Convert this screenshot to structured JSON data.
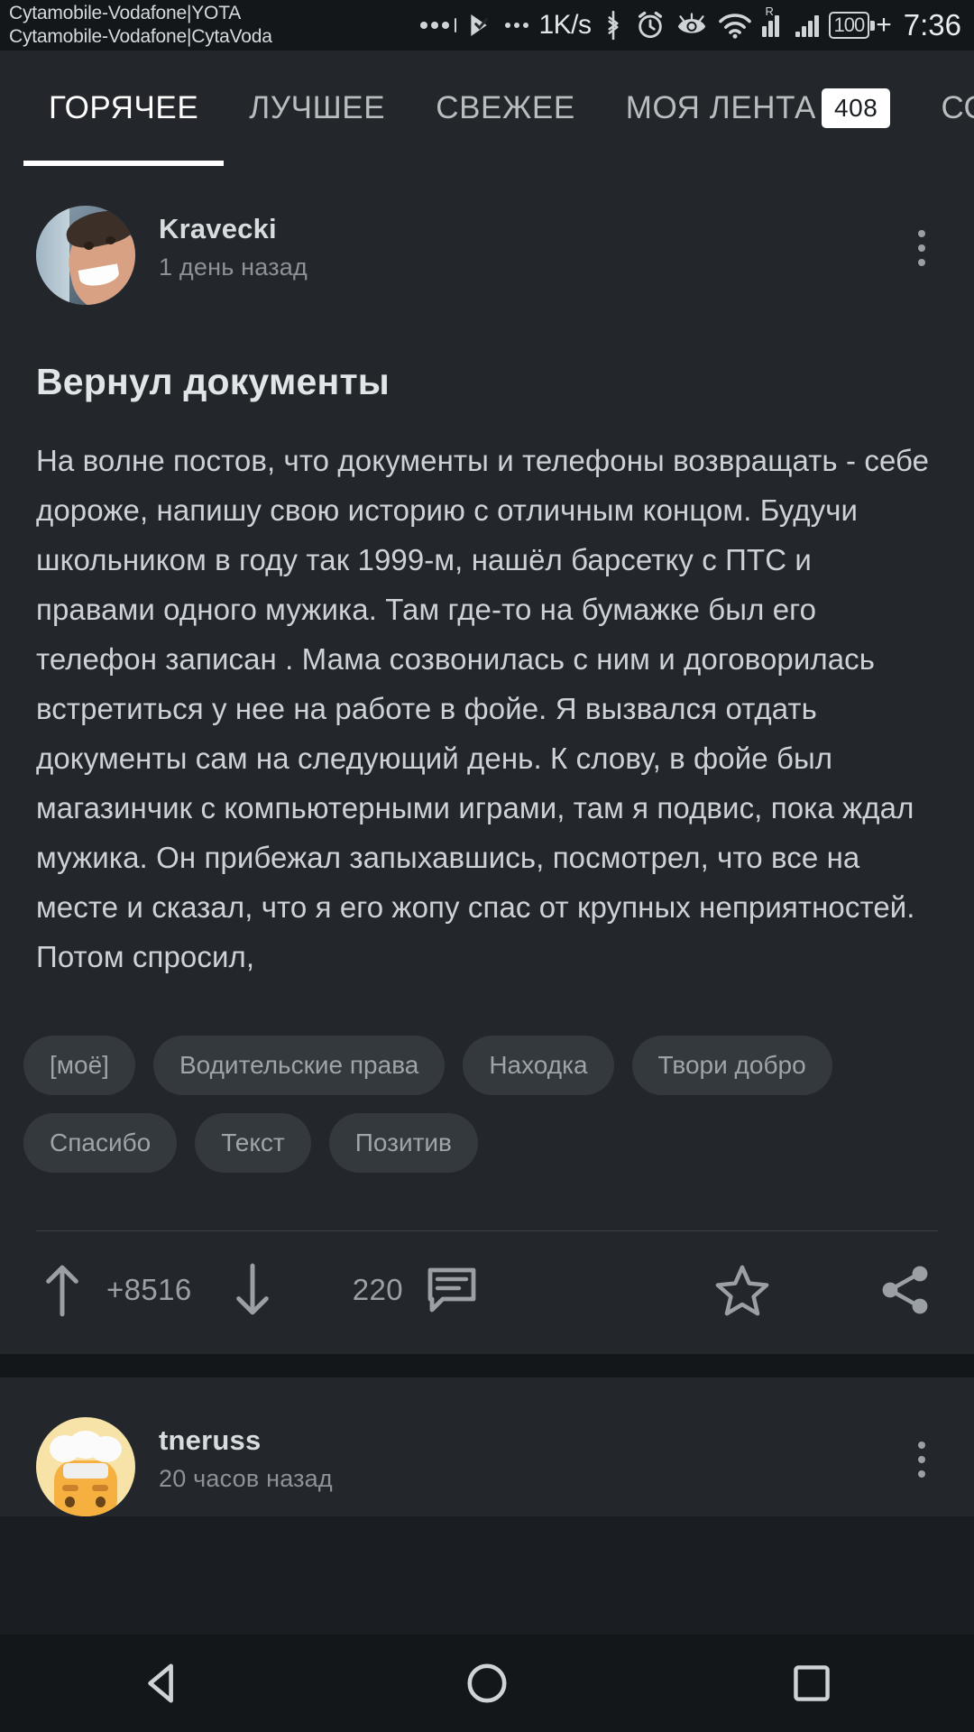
{
  "statusbar": {
    "carrier_line1": "Cytamobile-Vodafone|YOTA",
    "carrier_line2": "Cytamobile-Vodafone|CytaVoda",
    "net_speed": "1K/s",
    "battery_level": "100",
    "battery_plus": "+",
    "clock": "7:36",
    "roaming_label": "R",
    "icons": [
      "more-dots-icon",
      "play-check-icon",
      "ellipsis-icon",
      "bluetooth-icon",
      "alarm-icon",
      "eye-icon",
      "wifi-icon",
      "signal-icon",
      "signal-icon",
      "battery-icon"
    ]
  },
  "tabs": [
    {
      "label": "ГОРЯЧЕЕ",
      "active": true,
      "badge": ""
    },
    {
      "label": "ЛУЧШЕЕ",
      "active": false,
      "badge": ""
    },
    {
      "label": "СВЕЖЕЕ",
      "active": false,
      "badge": ""
    },
    {
      "label": "МОЯ ЛЕНТА",
      "active": false,
      "badge": "408"
    },
    {
      "label": "СО",
      "active": false,
      "badge": ""
    }
  ],
  "posts": [
    {
      "author": "Kravecki",
      "time": "1 день назад",
      "title": "Вернул документы",
      "body": "На волне постов, что документы и телефоны возвращать - себе дороже, напишу свою историю с отличным концом. Будучи школьником в году так 1999-м, нашёл барсетку с ПТС и правами одного мужика. Там где-то на бумажке был его телефон записан . Мама созвонилась с ним и договорилась встретиться у нее на работе в фойе. Я вызвался отдать документы сам на следующий день.  К слову, в фойе был магазинчик с компьютерными играми, там я подвис, пока ждал мужика. Он прибежал запыхавшись, посмотрел, что все на месте и сказал, что я его жопу спас от крупных неприятностей. Потом спросил,",
      "tags": [
        "[моё]",
        "Водительские права",
        "Находка",
        "Твори добро",
        "Спасибо",
        "Текст",
        "Позитив"
      ],
      "upvotes": "+8516",
      "comments": "220"
    },
    {
      "author": "tneruss",
      "time": "20 часов назад"
    }
  ],
  "actions": {
    "upvote": "upvote-arrow-icon",
    "downvote": "downvote-arrow-icon",
    "comment": "comment-icon",
    "favorite": "star-icon",
    "share": "share-icon"
  },
  "navbar": {
    "back": "back-triangle-icon",
    "home": "home-circle-icon",
    "recents": "recents-square-icon"
  },
  "colors": {
    "background": "#141719",
    "card": "#23272b",
    "accent_text": "#ffffff",
    "muted_text": "#9aa0a4",
    "tag_bg": "#34393e"
  }
}
